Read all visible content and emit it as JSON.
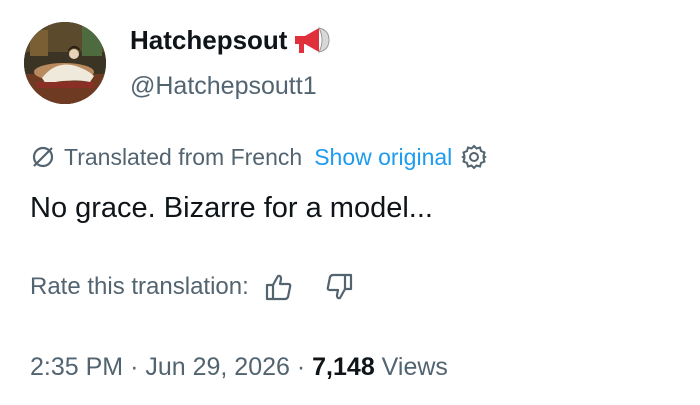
{
  "author": {
    "display_name": "Hatchepsout",
    "handle": "@Hatchepsoutt1",
    "name_emoji_icon": "megaphone-icon"
  },
  "translation": {
    "icon": "translate-icon",
    "label": "Translated from French",
    "show_original": "Show original",
    "settings_icon": "gear-icon"
  },
  "tweet": {
    "text": "No grace. Bizarre for a model..."
  },
  "rating": {
    "label": "Rate this translation:",
    "up_icon": "thumbs-up-icon",
    "down_icon": "thumbs-down-icon"
  },
  "meta": {
    "time": "2:35 PM",
    "separator": "·",
    "date": "Jun 29, 2026",
    "views_count": "7,148",
    "views_label": "Views"
  },
  "colors": {
    "text": "#0f1419",
    "secondary": "#536471",
    "link": "#1d9bf0",
    "megaphone_red": "#e0303b"
  }
}
